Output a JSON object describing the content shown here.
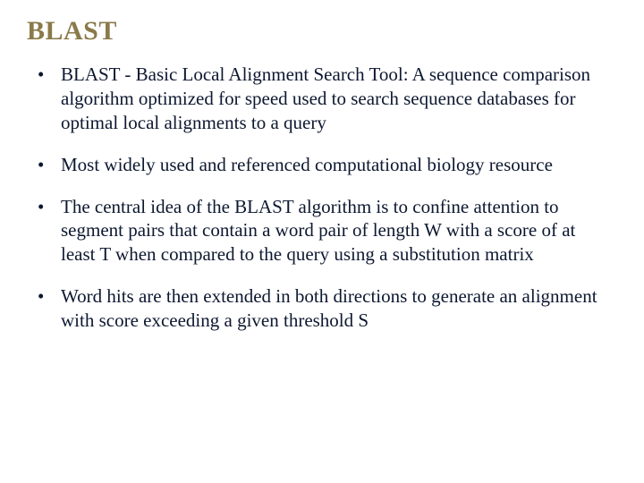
{
  "title": "BLAST",
  "bullets": [
    "BLAST - Basic Local Alignment Search Tool: A sequence comparison algorithm optimized for speed used to search sequence databases for optimal local alignments to a query",
    "Most widely used and referenced computational biology resource",
    "The central idea of the BLAST algorithm is to confine attention to segment pairs that contain a word pair of length W with a score of at least T when compared to the query using a substitution matrix",
    "Word hits are then extended in both directions to generate an alignment with score exceeding  a given threshold S"
  ]
}
